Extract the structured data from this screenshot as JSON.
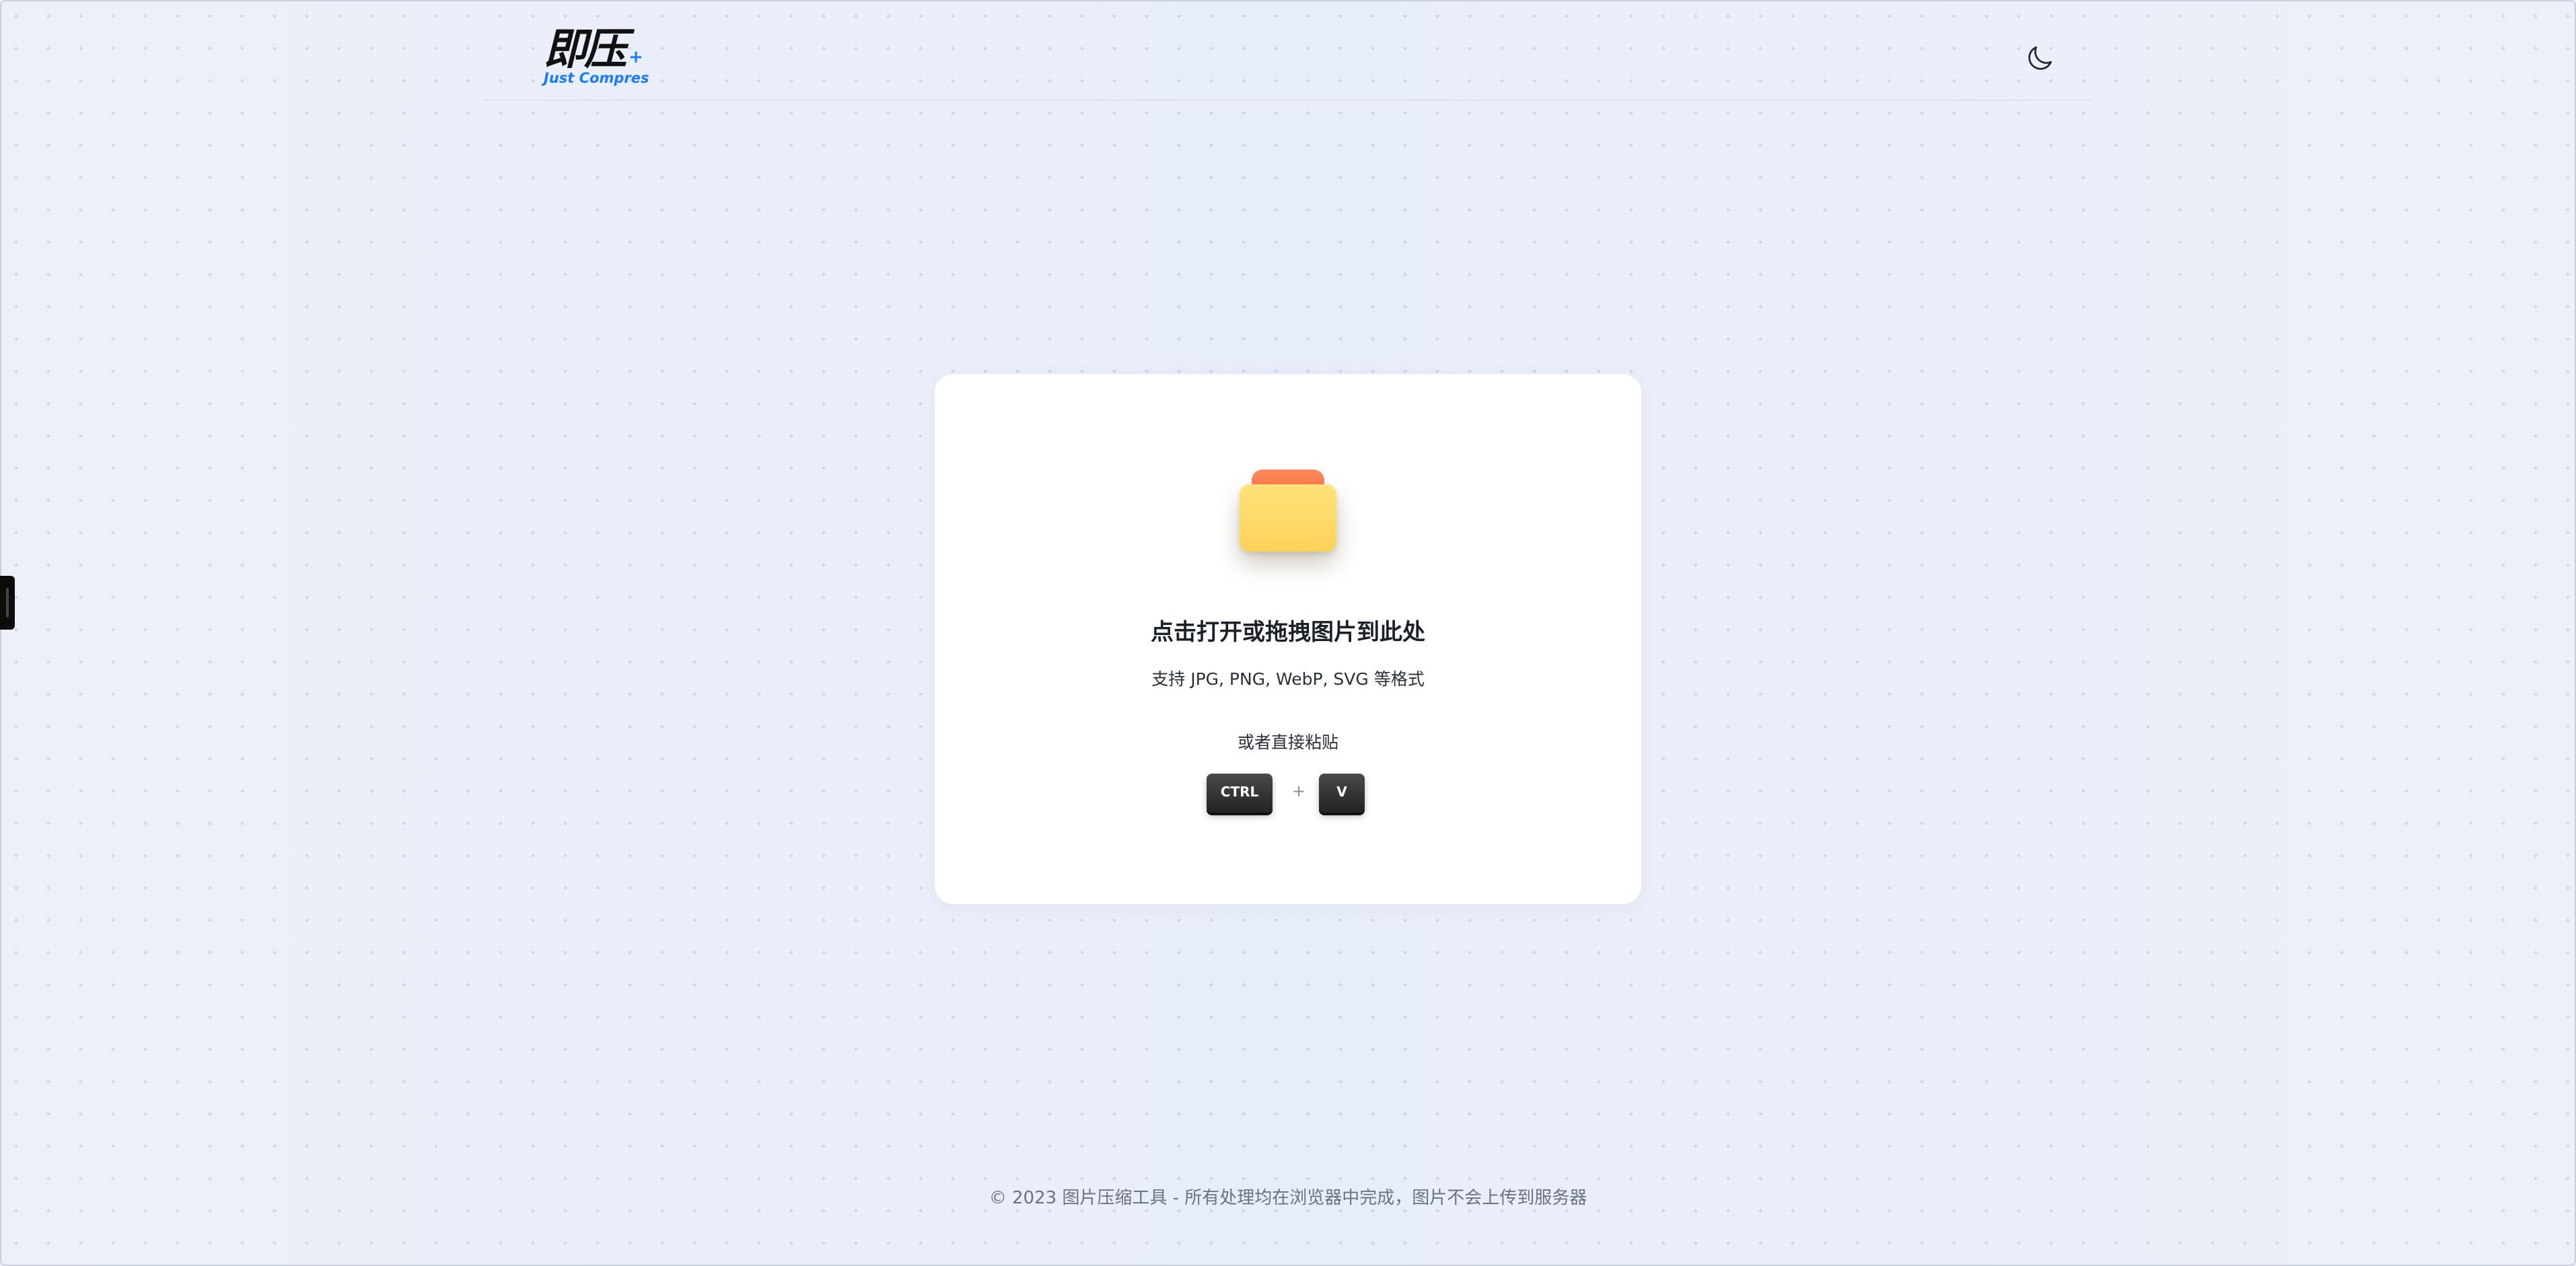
{
  "header": {
    "logo_text": "即压",
    "logo_subtitle": "Just Compres",
    "theme_toggle_icon": "moon-icon"
  },
  "upload": {
    "icon": "folder-icon",
    "title": "点击打开或拖拽图片到此处",
    "formats": "支持 JPG, PNG, WebP, SVG 等格式",
    "paste_hint": "或者直接粘贴",
    "shortcut": {
      "key1": "CTRL",
      "separator": "+",
      "key2": "V"
    }
  },
  "footer": {
    "text": "© 2023 图片压缩工具 - 所有处理均在浏览器中完成，图片不会上传到服务器"
  },
  "colors": {
    "background": "#edf0f8",
    "card": "#ffffff",
    "brand_blue": "#1b7bff",
    "folder_tab": "#ff7a4f",
    "folder_body": "#fdd866"
  }
}
